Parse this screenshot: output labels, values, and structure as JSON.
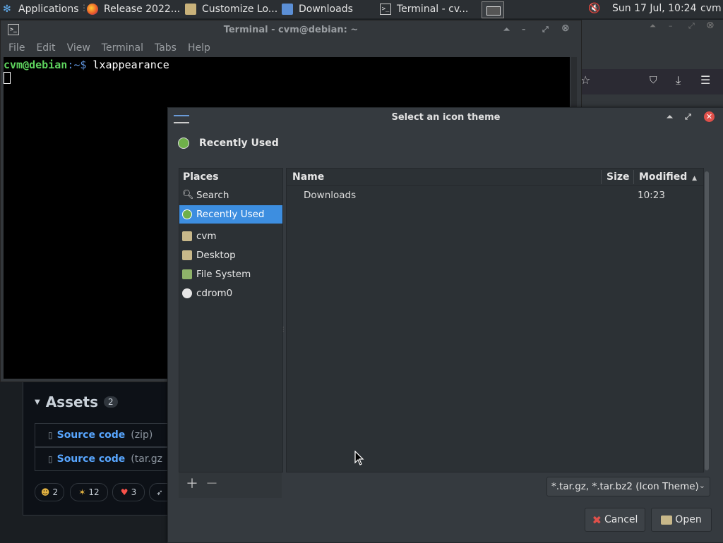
{
  "panel": {
    "applications": "Applications",
    "tasks": [
      "Release 2022...",
      "Customize Lo...",
      "Downloads",
      "Terminal - cv..."
    ],
    "clock": "Sun 17 Jul, 10:24",
    "user": "cvm"
  },
  "terminal": {
    "title": "Terminal - cvm@debian: ~",
    "menu": [
      "File",
      "Edit",
      "View",
      "Terminal",
      "Tabs",
      "Help"
    ],
    "prompt_user": "cvm@debian",
    "prompt_path": ":~$",
    "command": " lxappearance"
  },
  "github": {
    "assets_title": "Assets",
    "assets_count": "2",
    "asset1_label": "Source code",
    "asset1_ext": "(zip)",
    "asset2_label": "Source code",
    "asset2_ext": "(tar.gz",
    "reactions": [
      "2",
      "12",
      "3"
    ]
  },
  "dialog": {
    "title": "Select an icon theme",
    "location": "Recently Used",
    "places_header": "Places",
    "places": [
      "Search",
      "Recently Used",
      "cvm",
      "Desktop",
      "File System",
      "cdrom0"
    ],
    "columns": {
      "name": "Name",
      "size": "Size",
      "modified": "Modified"
    },
    "files": [
      {
        "name": "Downloads",
        "size": "",
        "modified": "10:23"
      }
    ],
    "filter": "*.tar.gz, *.tar.bz2 (Icon Theme)",
    "cancel": "Cancel",
    "open": "Open"
  },
  "colors": {
    "accent": "#3d8ee0",
    "prompt_green": "#5ed45e",
    "close_red": "#e0504a"
  }
}
